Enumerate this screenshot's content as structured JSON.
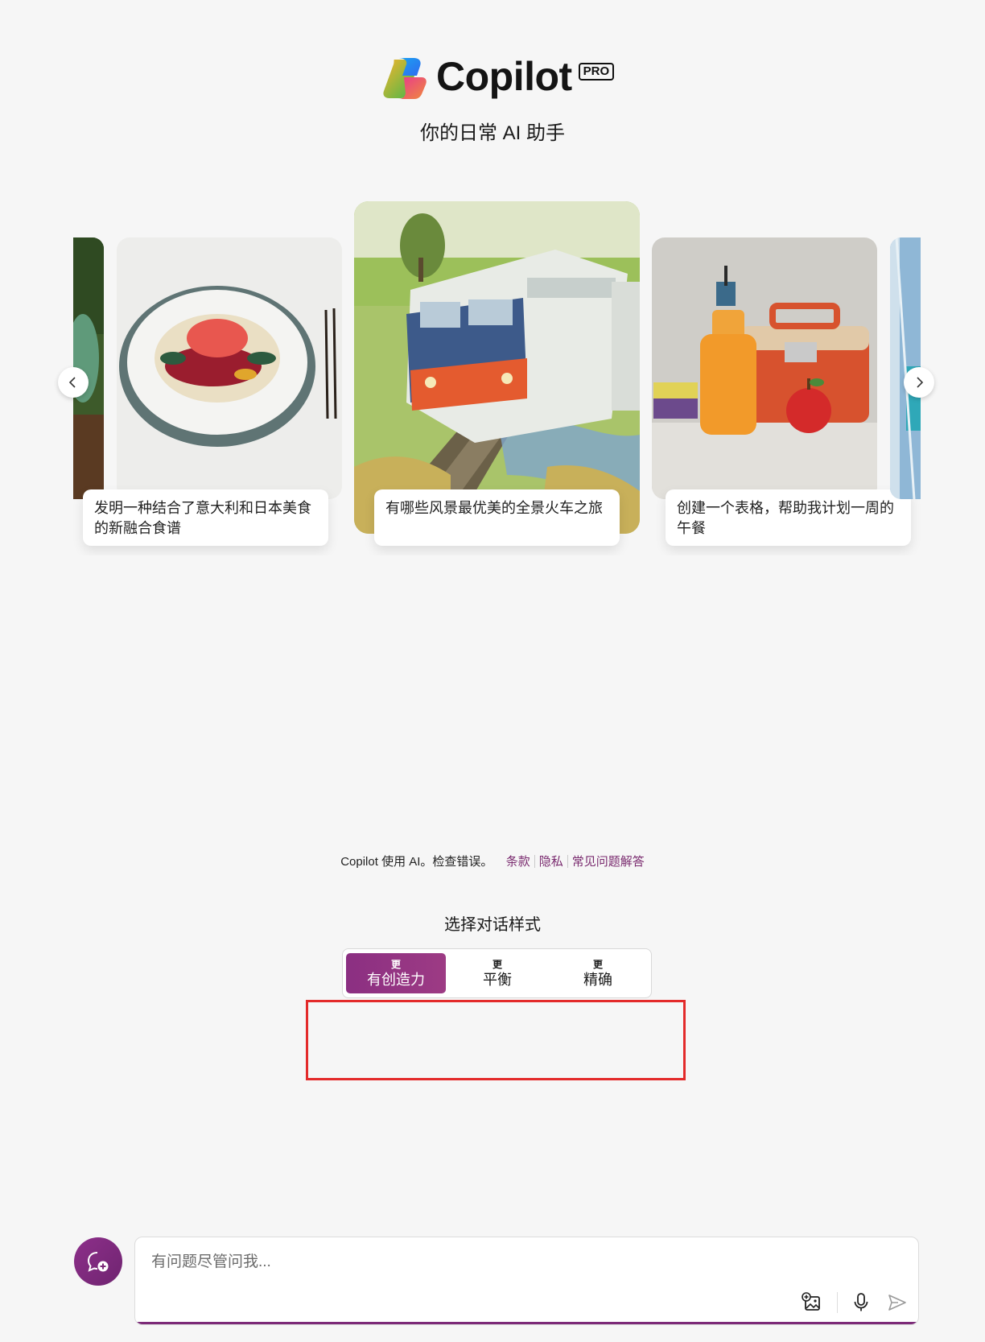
{
  "header": {
    "app_name": "Copilot",
    "badge": "PRO",
    "tagline": "你的日常 AI 助手"
  },
  "carousel": {
    "cards": [
      {
        "caption": "发明一种结合了意大利和日本美食的新融合食谱",
        "image": "fusion-dish-image"
      },
      {
        "caption": "有哪些风景最优美的全景火车之旅",
        "image": "train-image"
      },
      {
        "caption": "创建一个表格，帮助我计划一周的午餐",
        "image": "lunchbox-image"
      }
    ],
    "prev_icon": "chevron-left-icon",
    "next_icon": "chevron-right-icon"
  },
  "notice": {
    "text": "Copilot 使用 AI。检查错误。",
    "links": [
      "条款",
      "隐私",
      "常见问题解答"
    ]
  },
  "conversation_style": {
    "title": "选择对话样式",
    "options": [
      {
        "small": "更",
        "label": "有创造力",
        "selected": true
      },
      {
        "small": "更",
        "label": "平衡",
        "selected": false
      },
      {
        "small": "更",
        "label": "精确",
        "selected": false
      }
    ]
  },
  "composer": {
    "placeholder": "有问题尽管问我...",
    "new_topic_icon": "new-topic-icon",
    "tools": [
      "add-image-icon",
      "microphone-icon",
      "send-icon"
    ]
  },
  "colors": {
    "accent": "#8b2f82",
    "highlight": "#e32a2a",
    "background": "#f6f6f6"
  }
}
